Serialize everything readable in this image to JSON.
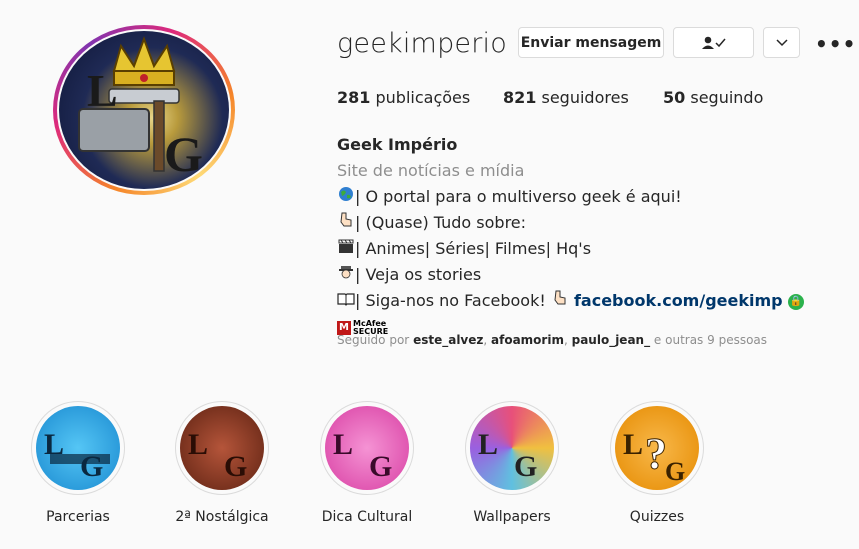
{
  "profile": {
    "username": "geekimperio",
    "buttons": {
      "message": "Enviar mensagem"
    },
    "stats": {
      "posts_count": "281",
      "posts_label": "publicações",
      "followers_count": "821",
      "followers_label": "seguidores",
      "following_count": "50",
      "following_label": "seguindo"
    },
    "bio": {
      "name": "Geek Império",
      "category": "Site de notícias e mídia",
      "line1": "| O portal para o multiverso geek é aqui!",
      "line2": "| (Quase) Tudo sobre:",
      "line3": "| Animes| Séries| Filmes| Hq's",
      "line4": "| Veja os stories",
      "line5": "| Siga-nos no Facebook! ",
      "link": "facebook.com/geekimp",
      "mcafee_line1": "McAfee",
      "mcafee_line2": "SECURE"
    },
    "followed_by": {
      "prefix": "Seguido por",
      "user1": "este_alvez",
      "user2": "afoamorim",
      "user3": "paulo_jean_",
      "suffix": "e outras 9 pessoas"
    }
  },
  "highlights": [
    {
      "label": "Parcerias",
      "color": "#1ea3e0"
    },
    {
      "label": "2ª Nostálgica",
      "color": "#8a3a22"
    },
    {
      "label": "Dica Cultural",
      "color": "#e45fb8"
    },
    {
      "label": "Wallpapers",
      "color": "#c86bd8"
    },
    {
      "label": "Quizzes",
      "color": "#f0950f"
    }
  ],
  "icons": {
    "globe": "globe-icon",
    "point_down": "pointing-hand-icon",
    "clapper": "clapperboard-icon",
    "detective": "detective-icon",
    "book": "book-icon"
  }
}
